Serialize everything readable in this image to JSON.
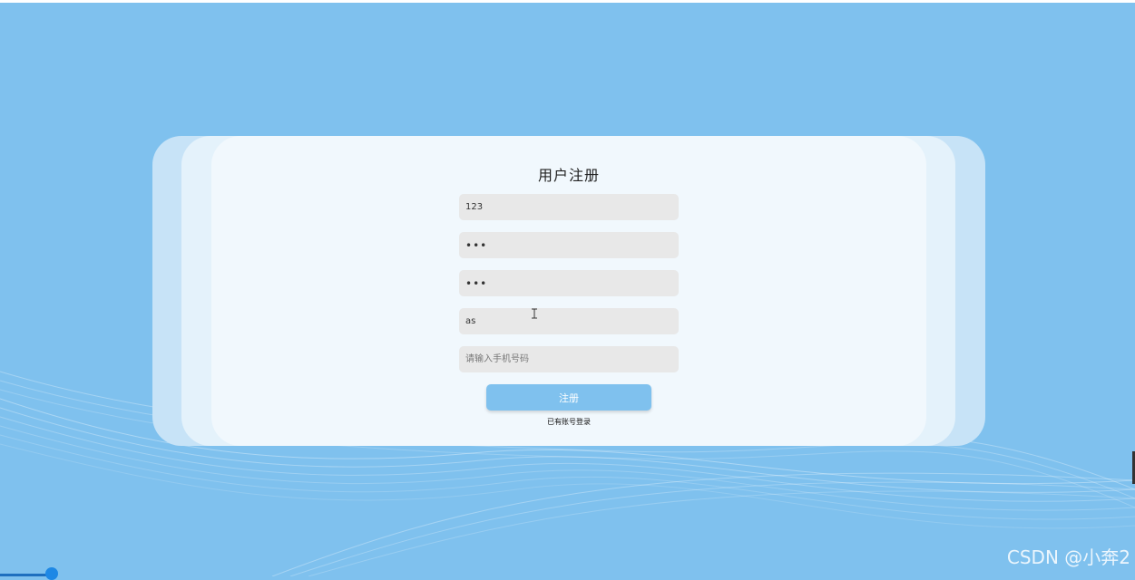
{
  "page": {
    "background_color": "#7fc1ee",
    "panel_colors": [
      "#c7e3f7",
      "#e4f2fb",
      "#f1f8fd"
    ]
  },
  "form": {
    "title": "用户注册",
    "fields": {
      "username": {
        "value": "123",
        "placeholder": ""
      },
      "password": {
        "value": "•••",
        "placeholder": ""
      },
      "confirm_password": {
        "value": "•••",
        "placeholder": ""
      },
      "extra": {
        "value": "as",
        "placeholder": ""
      },
      "phone": {
        "value": "",
        "placeholder": "请输入手机号码"
      }
    },
    "submit_label": "注册",
    "login_link": "已有账号登录"
  },
  "watermark": {
    "text": "CSDN @小奔2"
  },
  "icons": {
    "text_cursor": "text-cursor-icon"
  }
}
